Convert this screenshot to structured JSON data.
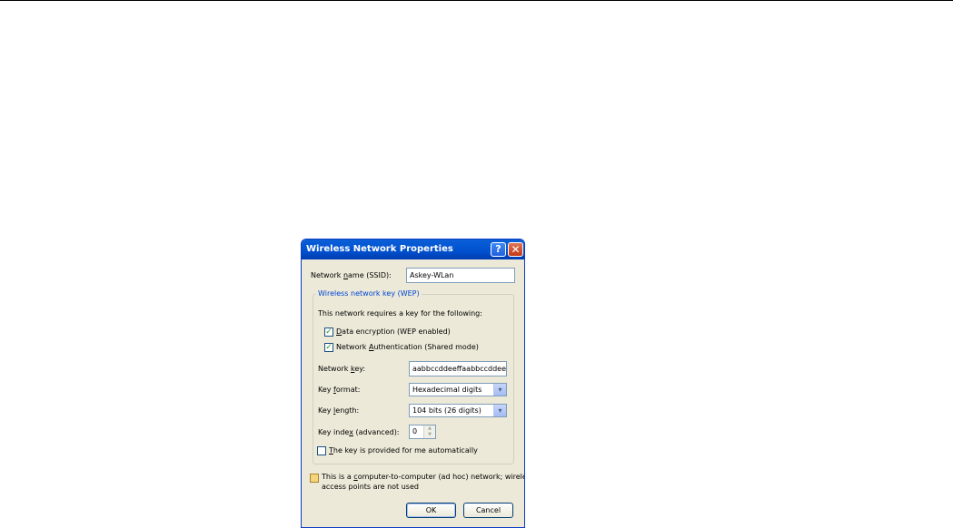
{
  "dialog": {
    "title": "Wireless Network Properties",
    "help_symbol": "?",
    "close_symbol": "✕",
    "ssid_label_pre": "Network ",
    "ssid_label_ul": "n",
    "ssid_label_post": "ame (SSID):",
    "ssid_value": "Askey-WLan",
    "group_title": "Wireless network key (WEP)",
    "requires_text": "This network requires a key for the following:",
    "data_encryption_ul": "D",
    "data_encryption_rest": "ata encryption (WEP enabled)",
    "data_encryption_checked": true,
    "network_auth_pre": "Network ",
    "network_auth_ul": "A",
    "network_auth_post": "uthentication (Shared mode)",
    "network_auth_checked": true,
    "network_key_label_pre": "Network ",
    "network_key_label_ul": "k",
    "network_key_label_post": "ey:",
    "network_key_value": "aabbccddeeffaabbccddeeff",
    "key_format_label_pre": "Key ",
    "key_format_label_ul": "f",
    "key_format_label_post": "ormat:",
    "key_format_value": "Hexadecimal digits",
    "key_length_label_pre": "Key ",
    "key_length_label_ul": "l",
    "key_length_label_post": "ength:",
    "key_length_value": "104 bits (26 digits)",
    "key_index_label_pre": "Key inde",
    "key_index_label_ul": "x",
    "key_index_label_post": " (advanced):",
    "key_index_value": "0",
    "auto_key_ul": "T",
    "auto_key_rest": "he key is provided for me automatically",
    "auto_key_checked": false,
    "adhoc_line1_pre": "This is a ",
    "adhoc_line1_ul": "c",
    "adhoc_line1_post": "omputer-to-computer (ad hoc) network; wireless",
    "adhoc_line2": "access points are not used",
    "adhoc_checked": false,
    "ok_label": "OK",
    "cancel_label": "Cancel",
    "check_mark": "✓",
    "combo_arrow": "▾",
    "spin_up": "▲",
    "spin_down": "▼"
  }
}
